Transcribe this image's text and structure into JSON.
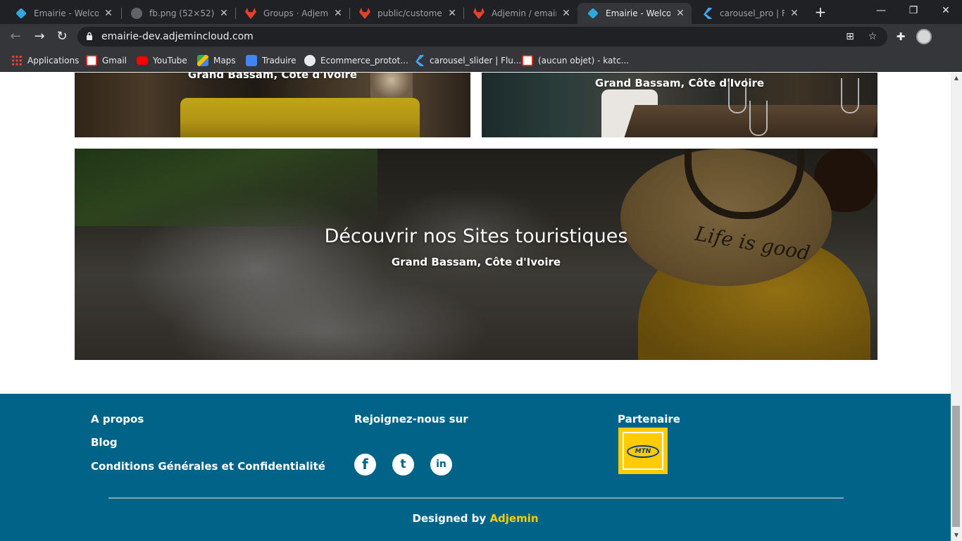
{
  "browser": {
    "tabs": [
      {
        "title": "Emairie - Welcome",
        "icon": "emairie-favicon",
        "color": "#2fa7e0"
      },
      {
        "title": "fb.png (52×52)",
        "icon": "globe-icon",
        "color": "#9aa0a6"
      },
      {
        "title": "Groups · Adjemin",
        "icon": "gitlab-icon",
        "color": "#e2432a"
      },
      {
        "title": "public/customer/in",
        "icon": "gitlab-icon",
        "color": "#e2432a"
      },
      {
        "title": "Adjemin / emairie",
        "icon": "gitlab-icon",
        "color": "#e2432a"
      },
      {
        "title": "Emairie - Welcome",
        "icon": "emairie-favicon",
        "color": "#2fa7e0",
        "active": true
      },
      {
        "title": "carousel_pro | Flut",
        "icon": "flutter-icon",
        "color": "#42a5f5"
      }
    ],
    "url": "emairie-dev.adjemincloud.com",
    "bookmarks": [
      {
        "label": "Applications",
        "icon": "apps-grid-icon"
      },
      {
        "label": "Gmail",
        "icon": "gmail-icon"
      },
      {
        "label": "YouTube",
        "icon": "youtube-icon"
      },
      {
        "label": "Maps",
        "icon": "maps-icon"
      },
      {
        "label": "Traduire",
        "icon": "translate-icon"
      },
      {
        "label": "Ecommerce_protot...",
        "icon": "github-icon"
      },
      {
        "label": "carousel_slider | Flu...",
        "icon": "flutter-icon"
      },
      {
        "label": "(aucun objet) - katc...",
        "icon": "gmail-icon"
      }
    ]
  },
  "cards": {
    "card1_caption": "Grand Bassam, Côte d'Ivoire",
    "card2_caption": "Grand Bassam, Côte d'Ivoire"
  },
  "hero": {
    "title": "Découvrir nos Sites touristiques",
    "subtitle": "Grand Bassam, Côte d'Ivoire",
    "hat_text": "Life is good"
  },
  "footer": {
    "links": [
      "A propos",
      "Blog",
      "Conditions Générales et Confidentialité"
    ],
    "social_heading": "Rejoignez-nous sur",
    "social": [
      {
        "label": "f",
        "icon": "facebook-icon"
      },
      {
        "label": "t",
        "icon": "twitter-icon"
      },
      {
        "label": "in",
        "icon": "linkedin-icon"
      }
    ],
    "partner_heading": "Partenaire",
    "partner_logo_text": "MTN",
    "credit_prefix": "Designed by",
    "credit_brand": "Adjemin",
    "bg_color": "#006387",
    "accent_color": "#ffcb05"
  }
}
